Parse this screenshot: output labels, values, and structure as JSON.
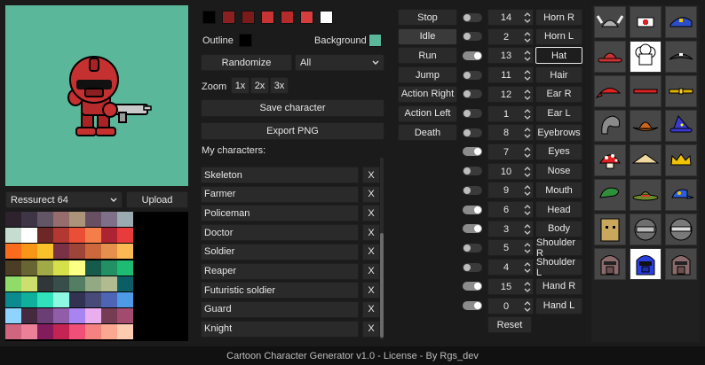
{
  "left": {
    "palette_name": "Ressurect 64",
    "upload_label": "Upload",
    "preview_bg": "#5bb79a",
    "palette_colors": [
      "#2e222f",
      "#3e3546",
      "#625565",
      "#966c6c",
      "#ab947a",
      "#694f62",
      "#7f708a",
      "#9babb2",
      "#c7dcd0",
      "#ffffff",
      "#6e2727",
      "#b33831",
      "#ea4f36",
      "#f57d4a",
      "#ae2334",
      "#e83b3b",
      "#fb6b1d",
      "#f79617",
      "#f9c22b",
      "#7a3045",
      "#9e4539",
      "#cd683d",
      "#e6904e",
      "#fbb954",
      "#4c3e24",
      "#676633",
      "#a2a947",
      "#d5e04b",
      "#fbff86",
      "#165a4c",
      "#239063",
      "#1ebc73",
      "#91db69",
      "#cddf6c",
      "#313638",
      "#374e4a",
      "#547e64",
      "#92a984",
      "#b2ba90",
      "#0b5e65",
      "#0b8a8f",
      "#0eaf9b",
      "#30e1b9",
      "#8ff8e2",
      "#323353",
      "#484a77",
      "#4d65b4",
      "#4d9be6",
      "#8fd3ff",
      "#45293f",
      "#6b3e75",
      "#905ea9",
      "#a884f3",
      "#eaaded",
      "#753c54",
      "#a24b6f",
      "#cf657f",
      "#ed8099",
      "#831c5d",
      "#c32454",
      "#f04f78",
      "#f68181",
      "#fca790",
      "#fdcbb0"
    ]
  },
  "middle": {
    "top_swatches": [
      "#000000",
      "#8c1f1f",
      "#7a1a1a",
      "#c83333",
      "#b52a2a",
      "#d63d3d",
      "#ffffff"
    ],
    "outline_label": "Outline",
    "outline_color": "#000000",
    "background_label": "Background",
    "background_color": "#5bb79a",
    "randomize_label": "Randomize",
    "filter_value": "All",
    "zoom_label": "Zoom",
    "zoom_options": [
      "1x",
      "2x",
      "3x"
    ],
    "save_label": "Save character",
    "export_label": "Export PNG",
    "my_characters_label": "My characters:",
    "characters": [
      "Skeleton",
      "Farmer",
      "Policeman",
      "Doctor",
      "Soldier",
      "Reaper",
      "Futuristic soldier",
      "Guard",
      "Knight"
    ],
    "delete_label": "X"
  },
  "animations": [
    "Stop",
    "Idle",
    "Run",
    "Jump",
    "Action Right",
    "Action Left",
    "Death"
  ],
  "parts": [
    {
      "name": "Horn R",
      "value": "14",
      "toggle": "off"
    },
    {
      "name": "Horn L",
      "value": "2",
      "toggle": "off"
    },
    {
      "name": "Hat",
      "value": "13",
      "toggle": "on",
      "selected": true
    },
    {
      "name": "Hair",
      "value": "11",
      "toggle": "off"
    },
    {
      "name": "Ear R",
      "value": "12",
      "toggle": "off"
    },
    {
      "name": "Ear L",
      "value": "1",
      "toggle": "off"
    },
    {
      "name": "Eyebrows",
      "value": "8",
      "toggle": "off"
    },
    {
      "name": "Eyes",
      "value": "7",
      "toggle": "on"
    },
    {
      "name": "Nose",
      "value": "10",
      "toggle": "off"
    },
    {
      "name": "Mouth",
      "value": "9",
      "toggle": "off"
    },
    {
      "name": "Head",
      "value": "6",
      "toggle": "on"
    },
    {
      "name": "Body",
      "value": "3",
      "toggle": "on"
    },
    {
      "name": "Shoulder R",
      "value": "5",
      "toggle": "off"
    },
    {
      "name": "Shoulder L",
      "value": "4",
      "toggle": "off"
    },
    {
      "name": "Hand R",
      "value": "15",
      "toggle": "on"
    },
    {
      "name": "Hand L",
      "value": "0",
      "toggle": "on"
    }
  ],
  "reset_label": "Reset",
  "footer": "Cartoon Character Generator v1.0 - License - By Rgs_dev"
}
